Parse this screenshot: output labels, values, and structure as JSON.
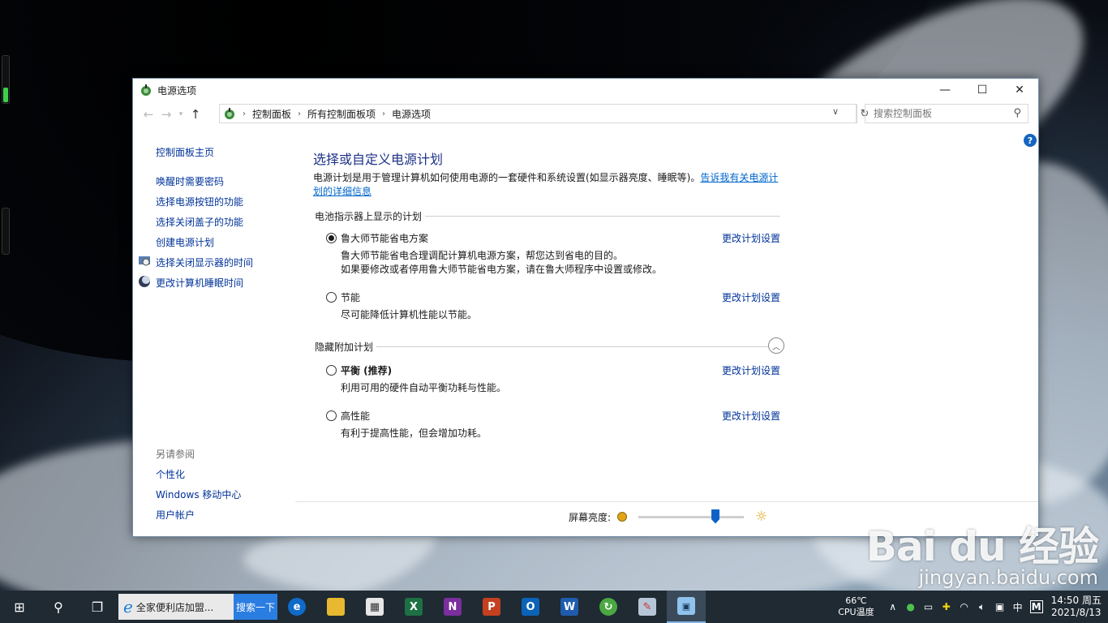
{
  "window": {
    "title": "电源选项"
  },
  "address": {
    "crumbs": [
      "控制面板",
      "所有控制面板项",
      "电源选项"
    ],
    "search_placeholder": "搜索控制面板"
  },
  "sidebar": {
    "home": "控制面板主页",
    "links": [
      "唤醒时需要密码",
      "选择电源按钮的功能",
      "选择关闭盖子的功能",
      "创建电源计划",
      "选择关闭显示器的时间",
      "更改计算机睡眠时间"
    ],
    "see_also_heading": "另请参阅",
    "see_also": [
      "个性化",
      "Windows 移动中心",
      "用户帐户"
    ]
  },
  "main": {
    "heading": "选择或自定义电源计划",
    "desc": "电源计划是用于管理计算机如何使用电源的一套硬件和系统设置(如显示器亮度、睡眠等)。",
    "desc_link": "告诉我有关电源计划的详细信息",
    "group1": "电池指示器上显示的计划",
    "group2": "隐藏附加计划",
    "change_label": "更改计划设置",
    "plans": [
      {
        "name": "鲁大师节能省电方案",
        "desc1": "鲁大师节能省电合理调配计算机电源方案，帮您达到省电的目的。",
        "desc2": "如果要修改或者停用鲁大师节能省电方案，请在鲁大师程序中设置或修改。",
        "selected": true
      },
      {
        "name": "节能",
        "desc1": "尽可能降低计算机性能以节能。",
        "selected": false
      },
      {
        "name": "平衡 (推荐)",
        "desc1": "利用可用的硬件自动平衡功耗与性能。",
        "selected": false
      },
      {
        "name": "高性能",
        "desc1": "有利于提高性能，但会增加功耗。",
        "selected": false
      }
    ],
    "brightness_label": "屏幕亮度:",
    "brightness_level": 0.75
  },
  "taskbar": {
    "ie_text": "全家便利店加盟...",
    "search_btn": "搜索一下",
    "temp": "66℃",
    "temp_label": "CPU温度",
    "ime": "中",
    "ime2": "M",
    "time": "14:50 周五",
    "date": "2021/8/13"
  },
  "watermark": {
    "brand": "Bai du 经验",
    "url": "jingyan.baidu.com"
  },
  "colors": {
    "link": "#003399",
    "heading": "#1e3287",
    "taskbar": "#1f2a33",
    "accent": "#2a7de1"
  }
}
